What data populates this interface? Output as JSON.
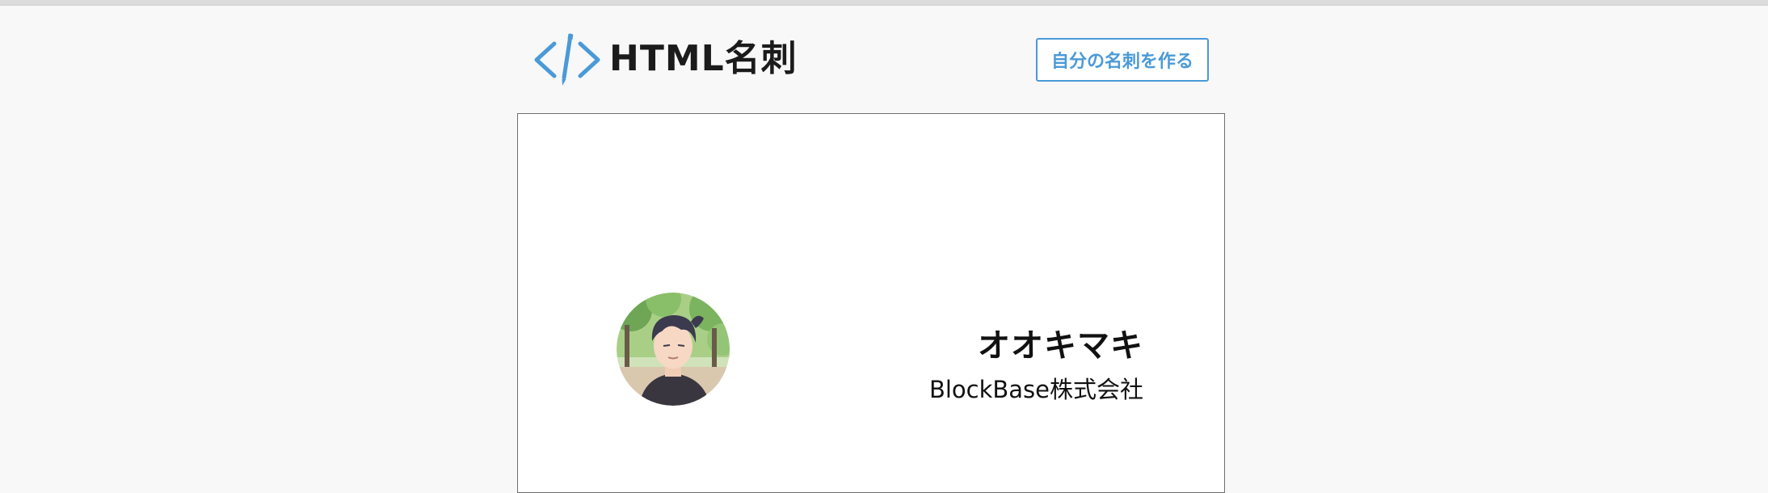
{
  "header": {
    "logo_text": "HTML名刺",
    "logo_icon": "code-pen-icon",
    "create_button_label": "自分の名刺を作る"
  },
  "card": {
    "avatar_icon": "avatar-illustration",
    "name": "オオキマキ",
    "company": "BlockBase株式会社"
  },
  "colors": {
    "accent": "#4a9ad8",
    "text": "#1b1b1b",
    "page_background": "#f8f8f8",
    "card_border": "#6f6f6f"
  }
}
